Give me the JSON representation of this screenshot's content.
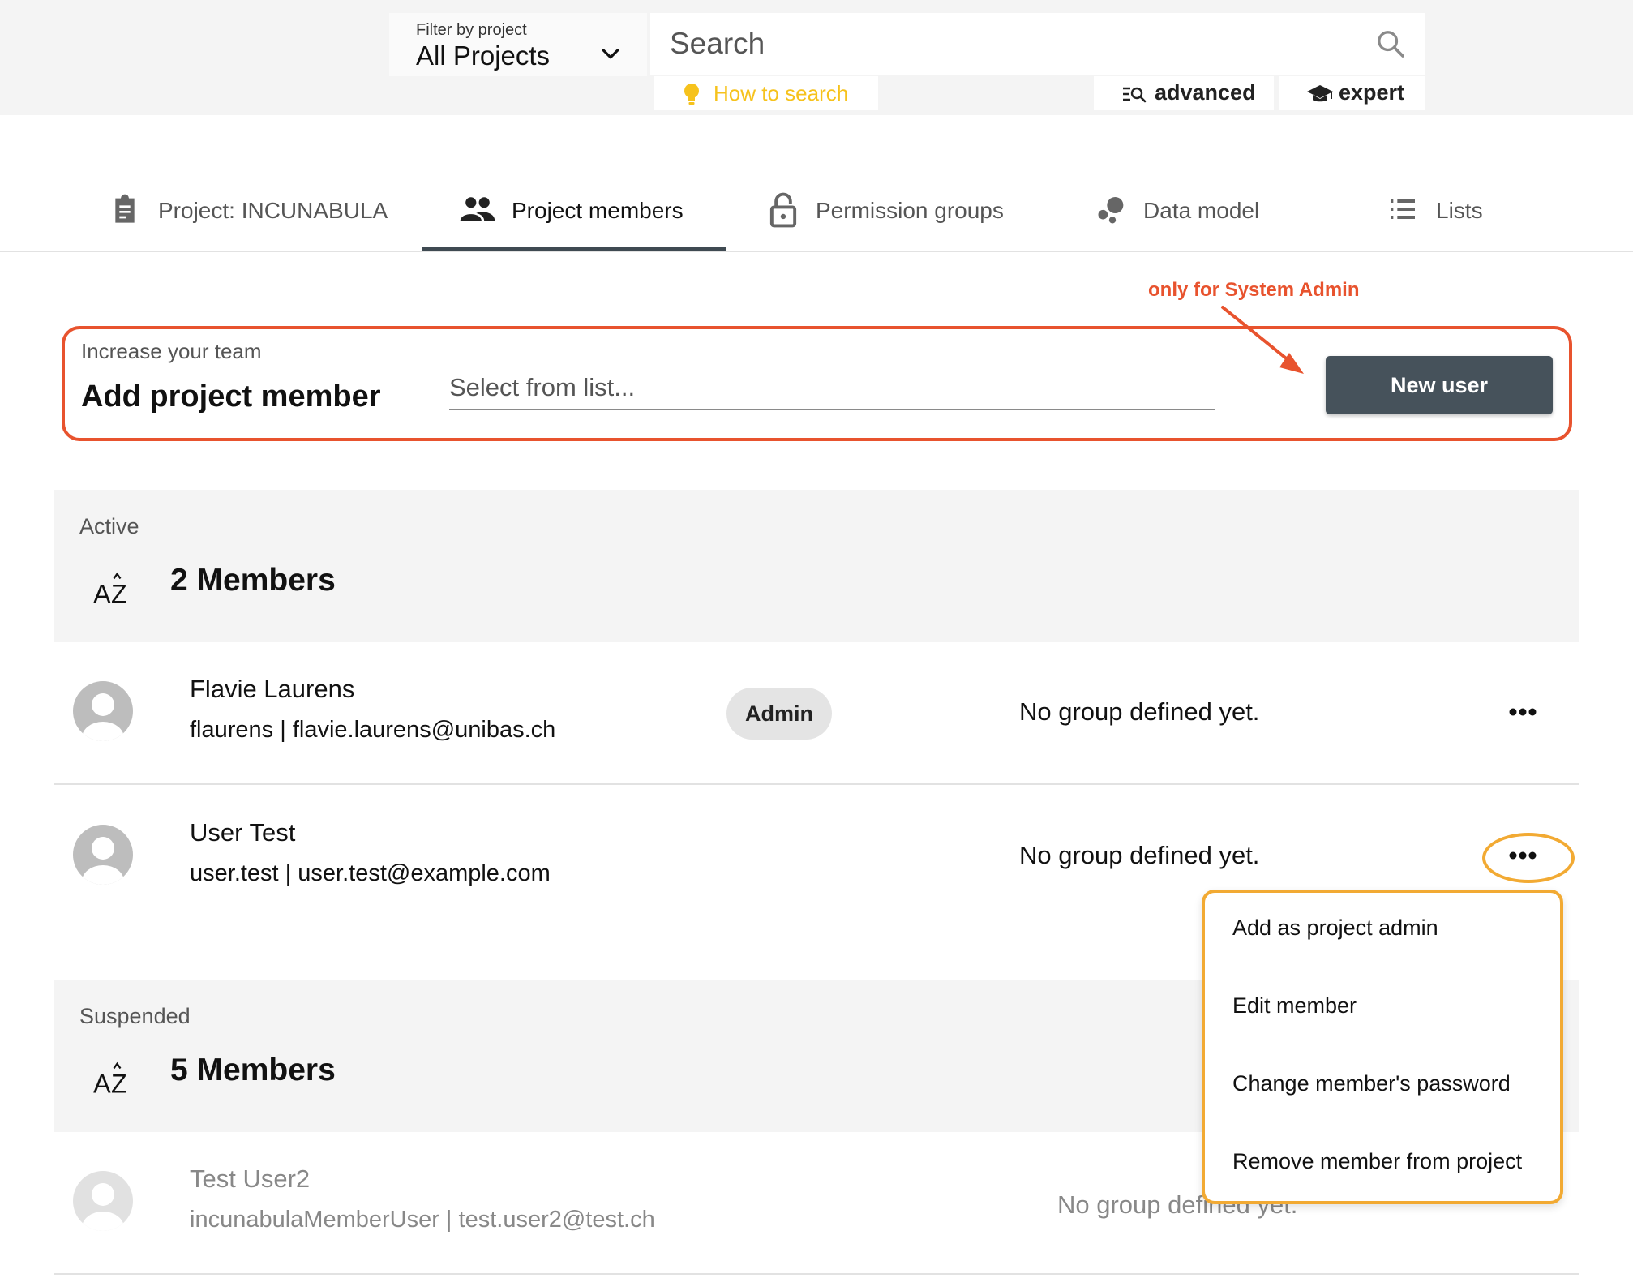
{
  "topbar": {
    "filter_caption": "Filter by project",
    "filter_value": "All Projects",
    "search_placeholder": "Search",
    "how_to_search": "How to search",
    "advanced_label": "advanced",
    "expert_label": "expert",
    "accent_color": "#f6c21c"
  },
  "tabs": [
    {
      "label": "Project: INCUNABULA",
      "icon": "clipboard-icon",
      "active": false
    },
    {
      "label": "Project members",
      "icon": "group-icon",
      "active": true
    },
    {
      "label": "Permission groups",
      "icon": "lock-icon",
      "active": false
    },
    {
      "label": "Data model",
      "icon": "bubbles-icon",
      "active": false
    },
    {
      "label": "Lists",
      "icon": "list-icon",
      "active": false
    }
  ],
  "annotation": {
    "label": "only for System Admin",
    "color": "#e8532e"
  },
  "add_member": {
    "caption": "Increase your team",
    "title": "Add project member",
    "select_placeholder": "Select from list...",
    "new_user_label": "New user"
  },
  "active": {
    "caption": "Active",
    "count_label": "2 Members",
    "members": [
      {
        "name": "Flavie Laurens",
        "details": "flaurens | flavie.laurens@unibas.ch",
        "badge": "Admin",
        "groups": "No group defined yet."
      },
      {
        "name": "User Test",
        "details": "user.test | user.test@example.com",
        "badge": "",
        "groups": "No group defined yet."
      }
    ]
  },
  "context_menu": {
    "highlight_color": "#f2aa33",
    "items": [
      "Add  as project admin",
      "Edit member",
      "Change member's password",
      "Remove member from project"
    ]
  },
  "suspended": {
    "caption": "Suspended",
    "count_label": "5 Members",
    "members": [
      {
        "name": "Test User2",
        "details": "incunabulaMemberUser | test.user2@test.ch",
        "groups": "No group defined yet."
      }
    ]
  }
}
